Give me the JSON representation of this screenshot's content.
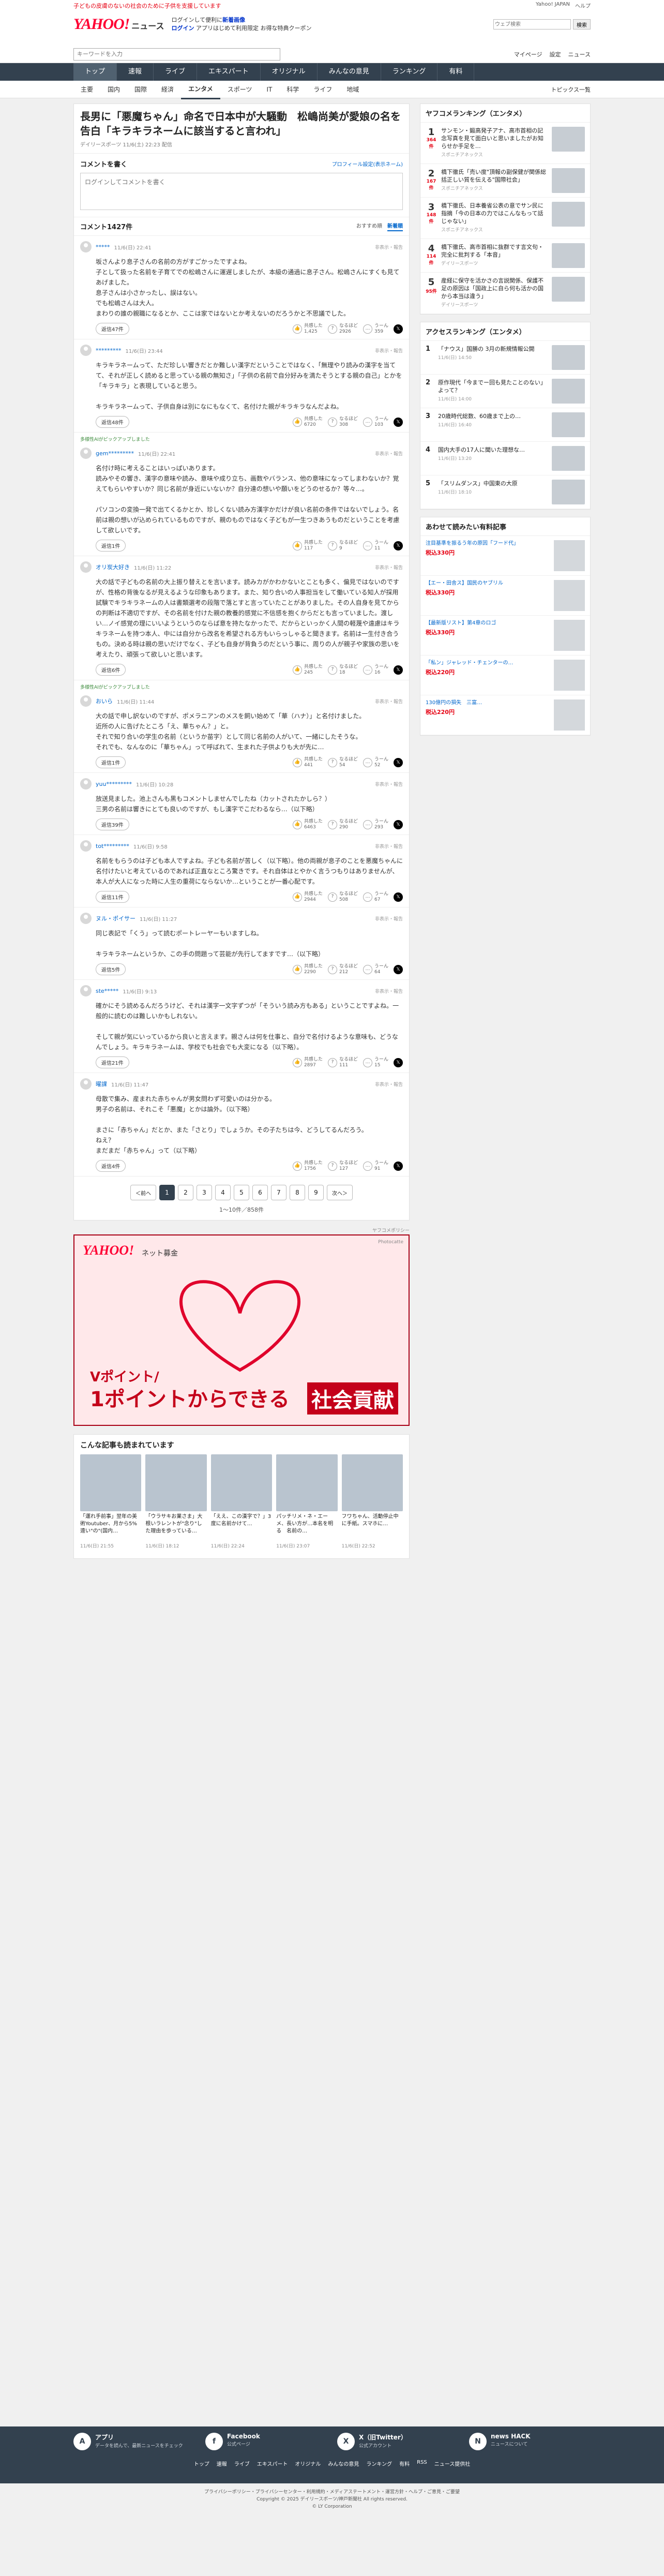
{
  "topbar": {
    "left": "子どもの皮膚のないの社会のために子供を支援しています",
    "right_links": [
      "Yahoo! JAPAN",
      "ヘルプ"
    ],
    "search_placeholder": "ウェブ検索",
    "search_btn": "検索"
  },
  "header": {
    "logo": "YAHOO!",
    "logo_sub": "JAPAN",
    "section": "ニュース",
    "promo_line1": "ログインして便利に",
    "promo_bold": "新着画像",
    "promo_line2": "ログイン",
    "promo_line3": "アプリはじめて利用限定",
    "promo_line4": "お得な特典クーポン"
  },
  "nav1": {
    "search_placeholder": "キーワードを入力",
    "links": [
      "マイページ",
      "設定",
      "ニュース"
    ]
  },
  "nav2": [
    "トップ",
    "速報",
    "ライブ",
    "エキスパート",
    "オリジナル",
    "みんなの意見",
    "ランキング",
    "有料"
  ],
  "nav3": {
    "items": [
      "主要",
      "国内",
      "国際",
      "経済",
      "エンタメ",
      "スポーツ",
      "IT",
      "科学",
      "ライフ",
      "地域"
    ],
    "active": "エンタメ",
    "topics": "トピックス一覧"
  },
  "article": {
    "title": "長男に「悪魔ちゃん」命名で日本中が大騒動　松嶋尚美が愛娘の名を告白「キラキラネームに該当すると言われ」",
    "meta": "デイリースポーツ 11/6(土) 22:23 配信"
  },
  "comment_box": {
    "label": "コメントを書く",
    "profile_link": "プロフィール設定(表示ネーム)",
    "placeholder": "ログインしてコメントを書く"
  },
  "comment_list": {
    "title": "コメント1427件",
    "sort_options": [
      "おすすめ順",
      "新着順"
    ],
    "sort_active": "新着順"
  },
  "comments": [
    {
      "expert_tag": "",
      "user": "*****",
      "time": "11/6(日) 22:41",
      "report": "非表示・報告",
      "body": "坂さんより息子さんの名前の方がすごかったですよね。\n子として扱った名前を子育てでの松嶋さんに運遅しましたが、本級の通過に息子さん。松嶋さんにすくも見てあげました。\n息子さんは小さかったし、誤はない。\nでも松嶋さんは大人。\nまわりの誰の親職になるとか、ここは家ではないとか考えないのだろうかと不思議でした。",
      "reply": "返信47件",
      "good": "1,425",
      "bad": "2926",
      "sowa": "359"
    },
    {
      "expert_tag": "",
      "user": "*********",
      "time": "11/6(日) 23:44",
      "report": "非表示・報告",
      "body": "キラキラネームって、ただ珍しい響きだとか難しい漢字だということではなく、「無理やり読みの漢字を当てて、それが正しく読めると思っている親の無知さ」「子供の名前で自分好みを満たそうとする親の自己」とかを「キラキラ」と表現していると思う。\n\nキラキラネームって、子供自身は別になにもなくて、名付けた親がキラキラなんだよね。",
      "reply": "返信48件",
      "good": "6720",
      "bad": "308",
      "sowa": "103"
    },
    {
      "expert_tag": "多様性AIがピックアップしました",
      "user": "gem*********",
      "time": "11/6(日) 22:41",
      "report": "非表示・報告",
      "body": "名付け時に考えることはいっぱいあります。\n読みやその響き、漢字の意味や読み、意味や成り立ち、画数やバランス、他の意味になってしまわないか？覚えてもらいやすいか？同じ名前が身近にいないか？自分達の想いや願いをどうのせるか？等々…。\n\nパソコンの変換一発で出てくるかとか、珍しくない読み方漢字かだけが良い名前の条件ではないでしょう。名前は親の想いが込められているものですが、親のものではなく子どもが一生つきあうものだということを考慮して欲しいです。",
      "reply": "返信1件",
      "good": "117",
      "bad": "9",
      "sowa": "11"
    },
    {
      "expert_tag": "",
      "user": "オリ炭大好き",
      "time": "11/6(日) 11:22",
      "report": "非表示・報告",
      "body": "大の話で子どもの名前の大上振り替えとを言います。読みカがかわかないとことも多く、偏見ではないのですが、性格の背後なるが見えるような印象もあります。また、知り合いの人事担当をして働いている知人が採用試験でキラキラネームの人は書類選考の段階で落とすと言っていたことがありました。その人自身を見てからの判断は不適切ですが、その名前を付けた親の教養的感覚に不信感を抱くからだとも言っていました。渡しい…ノイ感覚の理にいいようというのならば意を持たなかったで、だからといっかく人間の軽蔑や遠慮はキラキラネームを持つ本人、中には自分から改名を希望される方もいらっしゃると聞きます。名前は一生付き合うもの。決める時は親の思いだけでなく、子ども自身が背負うのだという事に、周りの人が親子や家族の思いを考えたり、頑張って欲しいと思います。",
      "reply": "返信6件",
      "good": "245",
      "bad": "18",
      "sowa": "16"
    },
    {
      "expert_tag": "多様性AIがピックアップしました",
      "user": "おいら",
      "time": "11/6(日) 11:44",
      "report": "非表示・報告",
      "body": "大の話で申し訳ないのですが、ポメラニアンのメスを飼い始めて「華（ハナ）」と名付けました。\n近所の人に告げたところ「え、華ちゃん？」と。\nそれで知り合いの学生の名前（というか苗字）として同じ名前の人がいて、一緒にしたそうな。\nそれでも、なんなのに「華ちゃん」って呼ばれて、生まれた子供よりも大が先に…",
      "reply": "返信1件",
      "good": "441",
      "bad": "54",
      "sowa": "52"
    },
    {
      "expert_tag": "",
      "user": "yuu*********",
      "time": "11/6(日) 10:28",
      "report": "非表示・報告",
      "body": "放送見ました。池上さんも黒もコメントしませんでしたね（カットされたかしら？）\n三男の名前は響きにとても良いのですが、もし漢字でこだわるなら…（以下略）",
      "reply": "返信39件",
      "good": "6463",
      "bad": "290",
      "sowa": "293"
    },
    {
      "expert_tag": "",
      "user": "tot*********",
      "time": "11/6(日) 9:58",
      "report": "非表示・報告",
      "body": "名前をもらうのは子ども本人ですよね。子ども名前が苦しく（以下略）。他の両親が息子のことを悪魔ちゃんに名付けたいと考えているのであれば正直なところ驚きです。それ自体はとやかく言うつもりはありませんが、本人が大人になった時に人生の重荷にならないか…ということが一番心配です。",
      "reply": "返信11件",
      "good": "2944",
      "bad": "508",
      "sowa": "67"
    },
    {
      "expert_tag": "",
      "user": "ヌル・ポイサー",
      "time": "11/6(日) 11:27",
      "report": "非表示・報告",
      "body": "同じ表記で「くう」って読むポートレーヤーもいますしね。\n\nキラキラネームというか、この手の問題って芸能が先行してますです…（以下略）",
      "reply": "返信5件",
      "good": "2290",
      "bad": "212",
      "sowa": "64"
    },
    {
      "expert_tag": "",
      "user": "ste*****",
      "time": "11/6(日) 9:13",
      "report": "非表示・報告",
      "body": "確かにそう読めるんだろうけど、それは漢字一文字ずつが「そういう読み方もある」ということですよね。一般的に読むのは難しいかもしれない。\n\nそして親が気にいっているから良いと言えます。親さんは何を仕事と、自分で名付けるような意味も、どうなんでしょう。キラキラネームは、学校でも社会でも大変になる（以下略）。",
      "reply": "返信21件",
      "good": "2897",
      "bad": "111",
      "sowa": "15"
    },
    {
      "expert_tag": "",
      "user": "曜課",
      "time": "11/6(日) 11:47",
      "report": "非表示・報告",
      "body": "母散で集み、産まれた赤ちゃんが男女問わず可愛いのは分かる。\n男子の名前は、それこそ「悪魔」とかは論外。（以下略）\n\nまさに「赤ちゃん」だとか、また「さとり」でしょうか。その子たちは今、どうしてるんだろう。\nねえ？\nまだまだ「赤ちゃん」って（以下略）",
      "reply": "返信4件",
      "good": "1756",
      "bad": "127",
      "sowa": "91"
    }
  ],
  "reactions": {
    "good": "共感した",
    "bad": "なるほど",
    "sowa": "うーん"
  },
  "pager": {
    "prev": "＜前へ",
    "pages": [
      "1",
      "2",
      "3",
      "4",
      "5",
      "6",
      "7",
      "8",
      "9"
    ],
    "next": "次へ＞",
    "info": "1～10件／858件"
  },
  "ad": {
    "label": "ヤフコメポリシー",
    "brand": "YAHOO!",
    "brand_sub": "ネット募金",
    "photo": "Photocatte",
    "line1": "Vポイント/",
    "line2": "1ポイントからできる",
    "line3": "社会貢献"
  },
  "related": {
    "title": "こんな記事も読まれています",
    "items": [
      {
        "title": "「運れ手前事」翌年の美術Youtuber、月から5%遠い\"の\"(国内…",
        "src": "11/6(日) 21:55"
      },
      {
        "title": "「ウラサキお業さま」大根いラレントが\"念り\"した理由を歩っている…",
        "src": "11/6(日) 18:12"
      },
      {
        "title": "「ええ、この漢字で？」3度に名前かけて…",
        "src": "11/6(日) 22:24"
      },
      {
        "title": "パッチリメ・ネ・エーメ、長い方が…本名を明る　名前の…",
        "src": "11/6(日) 23:07"
      },
      {
        "title": "フワちゃん、活動停止中に手紙。スマホに…",
        "src": "11/6(日) 22:52"
      }
    ]
  },
  "side": {
    "ranking_title": "ヤフコメランキング（エンタメ）",
    "ranking": [
      {
        "n": "1",
        "cnt": "364件",
        "title": "サンモン・鍛高発子アナ、高市首相の記念写真を見て面白いと思いましたがお知らせか手足を…",
        "src": "スポニチアネックス"
      },
      {
        "n": "2",
        "cnt": "167件",
        "title": "橋下徹氏「売い度\"頂報の副保健が関係総括正しい質を伝える\"国際社会」",
        "src": "スポニチアネックス"
      },
      {
        "n": "3",
        "cnt": "148件",
        "title": "橋下徹氏、日本養省公表の意でサン民に指摘「今の日本の力ではこんなもって話じゃない」",
        "src": "スポニチアネックス"
      },
      {
        "n": "4",
        "cnt": "114件",
        "title": "橋下徹氏、高市首相に抜群です言文句・完全に批判する「本音」",
        "src": "デイリースポーツ"
      },
      {
        "n": "5",
        "cnt": "95件",
        "title": "産経に保守を活かさの言説関係、保護不足の原因は「国政上に自ら何も活かの国から本当は違う」",
        "src": "デイリースポーツ"
      }
    ],
    "access_title": "アクセスランキング（エンタメ）",
    "access": [
      {
        "n": "1",
        "title": "「ナウス」国勝の 3月の新規情報公開",
        "src": "11/6(日) 14:50"
      },
      {
        "n": "2",
        "title": "原作現代「今までー回も見たことのない」よって？",
        "src": "11/6(日) 14:00"
      },
      {
        "n": "3",
        "title": "20歳時代総数、60歳まで上の…",
        "src": "11/6(日) 16:40"
      },
      {
        "n": "4",
        "title": "国内大手の17人に聞いた理想な…",
        "src": "11/6(日) 13:20"
      },
      {
        "n": "5",
        "title": "「スリムダンス」中国東の大原",
        "src": "11/6(日) 18:10"
      }
    ],
    "shop_title": "あわせて読みたい有料記事",
    "shop": [
      {
        "title": "注目基準を振るう年の原因「フード代」",
        "price": "税込330円"
      },
      {
        "title": "【エー・田舎ス】国民のヤブリル",
        "price": "税込330円"
      },
      {
        "title": "【最新版リスト】第4章のロゴ",
        "price": "税込330円"
      },
      {
        "title": "「私ン」ジャレッド・チェンターの…",
        "price": "税込220円"
      },
      {
        "title": "130億円の損失　三富…",
        "price": "税込220円"
      }
    ]
  },
  "footer": {
    "cols": [
      {
        "icon": "A",
        "title": "アプリ",
        "desc": "データを読んで、最新ニュースをチェック"
      },
      {
        "icon": "f",
        "title": "Facebook",
        "desc": "公式ページ"
      },
      {
        "icon": "X",
        "title": "X（旧Twitter）",
        "desc": "公式アカウント"
      },
      {
        "icon": "N",
        "title": "news HACK",
        "desc": "ニュースについて"
      }
    ],
    "links": [
      "トップ",
      "速報",
      "ライブ",
      "エキスパート",
      "オリジナル",
      "みんなの意見",
      "ランキング",
      "有料",
      "RSS",
      "ニュース提供社"
    ],
    "legal1": "プライバシーポリシー・プライバシーセンター・利用規約・メディアステートメント・運営方針・ヘルプ・ご意見・ご要望",
    "legal2": "Copyright © 2025 デイリースポーツ/神戸新聞社 All rights reserved.",
    "legal3": "© LY Corporation"
  }
}
